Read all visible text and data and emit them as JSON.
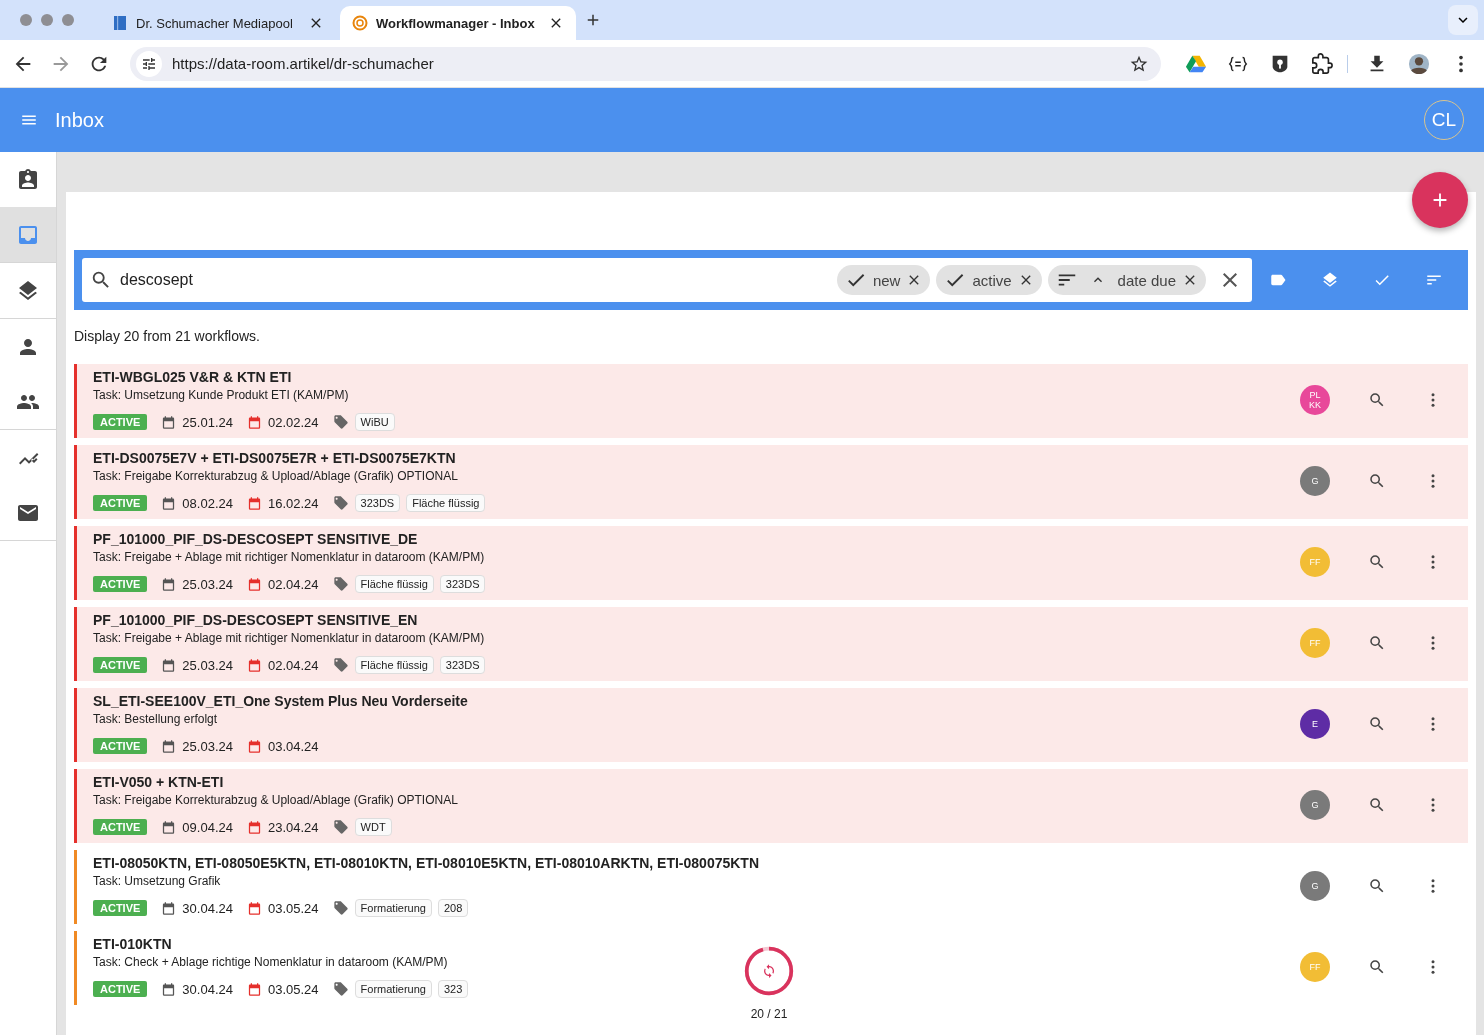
{
  "browser": {
    "tabs": [
      {
        "title": "Dr. Schumacher Mediapool",
        "kind": "book",
        "selected": false
      },
      {
        "title": "Workflowmanager - Inbox",
        "kind": "ring",
        "selected": true
      }
    ],
    "url": "https://data-room.artikel/dr-schumacher"
  },
  "app_bar": {
    "title": "Inbox",
    "user_initials": "CL"
  },
  "sidebar": {
    "items": [
      {
        "kind": "contact",
        "selected": false
      },
      {
        "kind": "inbox",
        "selected": true
      },
      {
        "kind": "layers",
        "selected": false
      },
      {
        "kind": "person",
        "selected": false
      },
      {
        "kind": "people",
        "selected": false
      },
      {
        "kind": "trend",
        "selected": false
      },
      {
        "kind": "mail",
        "selected": false
      }
    ]
  },
  "search": {
    "value": "descosept",
    "chips": [
      {
        "kind": "filter",
        "label": "new"
      },
      {
        "kind": "filter",
        "label": "active"
      },
      {
        "kind": "sort",
        "label": "date due"
      }
    ],
    "tools": [
      {
        "kind": "label"
      },
      {
        "kind": "layers"
      },
      {
        "kind": "check"
      },
      {
        "kind": "sort"
      }
    ]
  },
  "summary": "Display 20 from 21 workflows.",
  "workflows": [
    {
      "title": "ETI-WBGL025 V&R & KTN ETI",
      "task": "Task: Umsetzung Kunde Produkt ETI (KAM/PM)",
      "status": "ACTIVE",
      "start": "25.01.24",
      "due": "02.02.24",
      "tags": [
        "WiBU"
      ],
      "overdue": true,
      "avatar": {
        "initials": [
          "PL",
          "KK"
        ],
        "color": "#e8489a"
      }
    },
    {
      "title": "ETI-DS0075E7V + ETI-DS0075E7R + ETI-DS0075E7KTN",
      "task": "Task: Freigabe Korrekturabzug & Upload/Ablage (Grafik) OPTIONAL",
      "status": "ACTIVE",
      "start": "08.02.24",
      "due": "16.02.24",
      "tags": [
        "323DS",
        "Fläche flüssig"
      ],
      "overdue": true,
      "avatar": {
        "initials": [
          "G"
        ],
        "color": "#7a7a7a"
      }
    },
    {
      "title": "PF_101000_PIF_DS-DESCOSEPT SENSITIVE_DE",
      "task": "Task: Freigabe + Ablage mit richtiger Nomenklatur in dataroom (KAM/PM)",
      "status": "ACTIVE",
      "start": "25.03.24",
      "due": "02.04.24",
      "tags": [
        "Fläche flüssig",
        "323DS"
      ],
      "overdue": true,
      "avatar": {
        "initials": [
          "FF"
        ],
        "color": "#f2bd35"
      }
    },
    {
      "title": "PF_101000_PIF_DS-DESCOSEPT SENSITIVE_EN",
      "task": "Task: Freigabe + Ablage mit richtiger Nomenklatur in dataroom (KAM/PM)",
      "status": "ACTIVE",
      "start": "25.03.24",
      "due": "02.04.24",
      "tags": [
        "Fläche flüssig",
        "323DS"
      ],
      "overdue": true,
      "avatar": {
        "initials": [
          "FF"
        ],
        "color": "#f2bd35"
      }
    },
    {
      "title": "SL_ETI-SEE100V_ETI_One System Plus Neu Vorderseite",
      "task": "Task: Bestellung erfolgt",
      "status": "ACTIVE",
      "start": "25.03.24",
      "due": "03.04.24",
      "overdue": true,
      "avatar": {
        "initials": [
          "E"
        ],
        "color": "#5e2ca5"
      }
    },
    {
      "title": "ETI-V050 + KTN-ETI",
      "task": "Task: Freigabe Korrekturabzug & Upload/Ablage (Grafik) OPTIONAL",
      "status": "ACTIVE",
      "start": "09.04.24",
      "due": "23.04.24",
      "tags": [
        "WDT"
      ],
      "overdue": true,
      "avatar": {
        "initials": [
          "G"
        ],
        "color": "#7a7a7a"
      }
    },
    {
      "title": "ETI-08050KTN, ETI-08050E5KTN, ETI-08010KTN, ETI-08010E5KTN, ETI-08010ARKTN, ETI-080075KTN",
      "task": "Task: Umsetzung Grafik",
      "status": "ACTIVE",
      "start": "30.04.24",
      "due": "03.05.24",
      "tags": [
        "Formatierung",
        "208"
      ],
      "overdue": false,
      "avatar": {
        "initials": [
          "G"
        ],
        "color": "#7a7a7a"
      }
    },
    {
      "title": "ETI-010KTN",
      "task": "Task: Check + Ablage richtige Nomenklatur in dataroom (KAM/PM)",
      "status": "ACTIVE",
      "start": "30.04.24",
      "due": "03.05.24",
      "tags": [
        "Formatierung",
        "323"
      ],
      "overdue": false,
      "avatar": {
        "initials": [
          "FF"
        ],
        "color": "#f2bd35"
      }
    }
  ],
  "loader": {
    "count": "20 / 21",
    "level": 0.95
  }
}
